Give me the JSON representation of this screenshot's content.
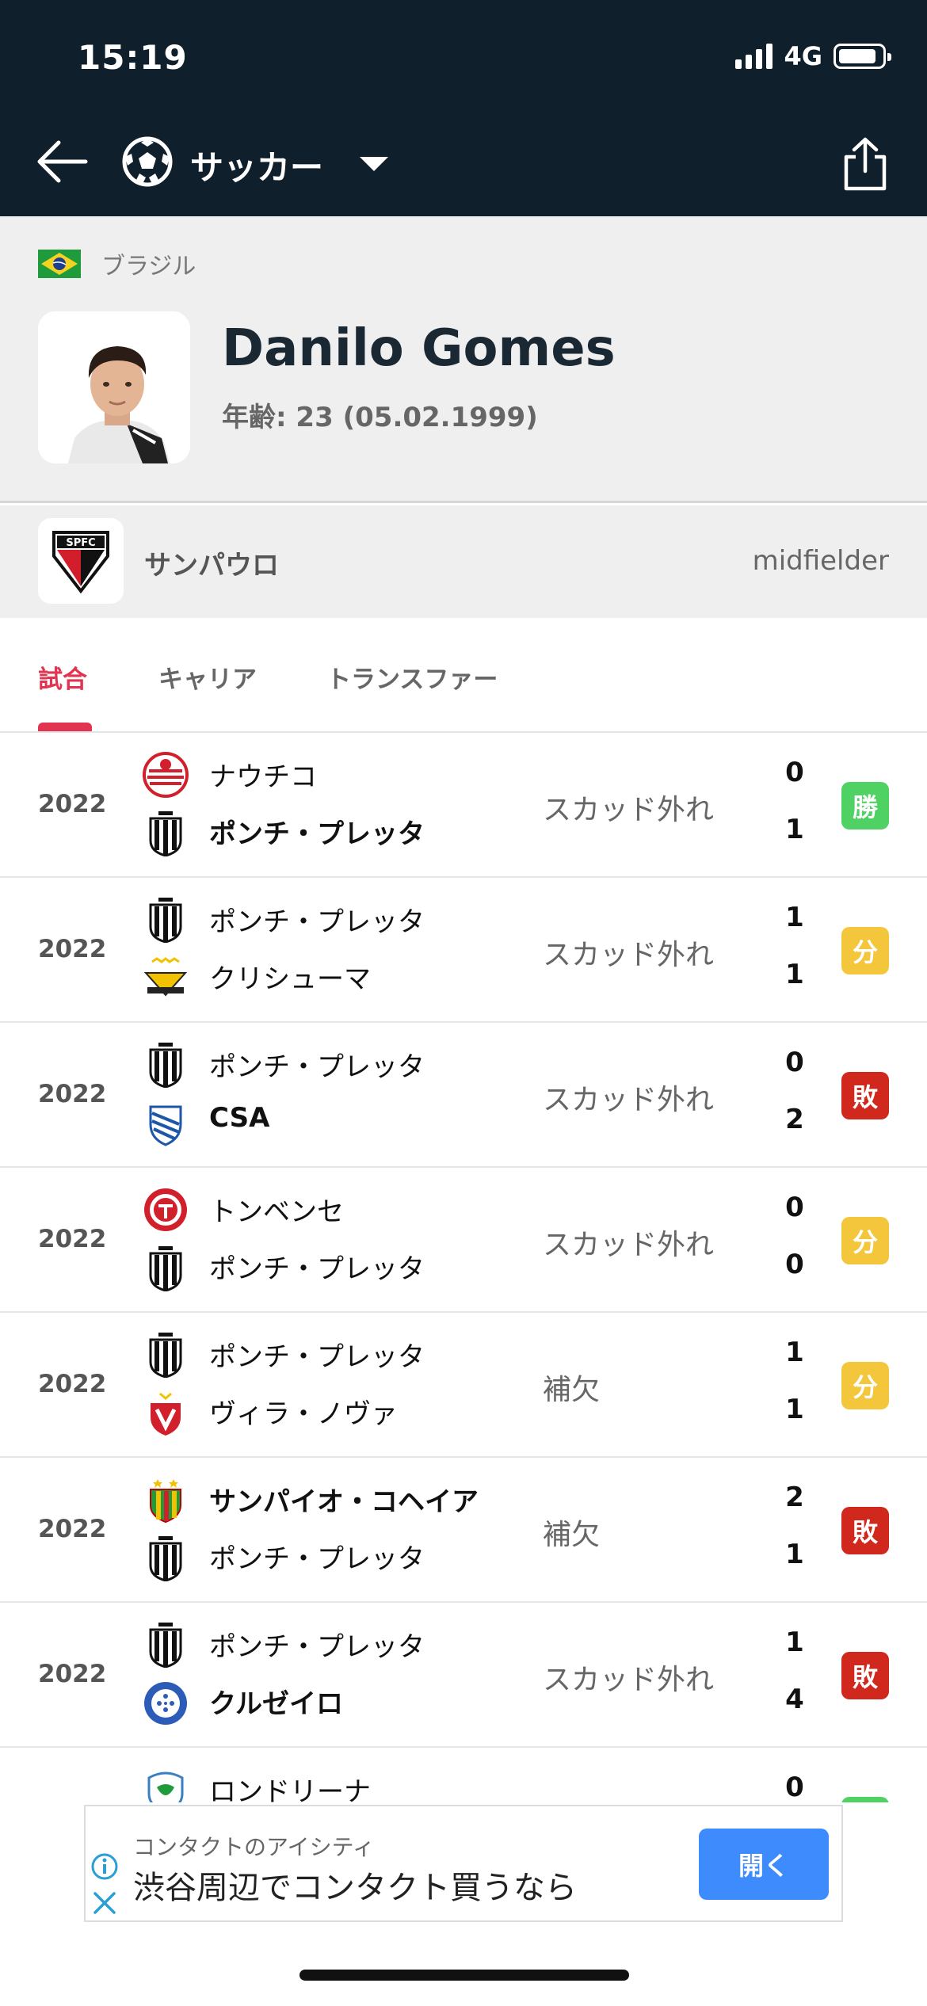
{
  "status": {
    "time": "15:19",
    "network": "4G"
  },
  "nav": {
    "sport": "サッカー"
  },
  "player": {
    "country": "ブラジル",
    "name": "Danilo Gomes",
    "age_line": "年齢: 23 (05.02.1999)"
  },
  "team": {
    "name": "サンパウロ",
    "position": "midfielder",
    "logo_text": "SPFC"
  },
  "tabs": [
    {
      "label": "試合",
      "active": true
    },
    {
      "label": "キャリア",
      "active": false
    },
    {
      "label": "トランスファー",
      "active": false
    }
  ],
  "matches": [
    {
      "year": "2022",
      "home": "ナウチコ",
      "away": "ポンチ・プレッタ",
      "status": "スカッド外れ",
      "home_score": "0",
      "away_score": "1",
      "result": "勝",
      "result_color": "#4fd163",
      "home_logo": "nautico-logo",
      "away_logo": "ponte-preta-logo",
      "winner": "away"
    },
    {
      "year": "2022",
      "home": "ポンチ・プレッタ",
      "away": "クリシューマ",
      "status": "スカッド外れ",
      "home_score": "1",
      "away_score": "1",
      "result": "分",
      "result_color": "#f3c63b",
      "home_logo": "ponte-preta-logo",
      "away_logo": "criciuma-logo",
      "winner": "none"
    },
    {
      "year": "2022",
      "home": "ポンチ・プレッタ",
      "away": "CSA",
      "status": "スカッド外れ",
      "home_score": "0",
      "away_score": "2",
      "result": "敗",
      "result_color": "#d0281c",
      "home_logo": "ponte-preta-logo",
      "away_logo": "csa-logo",
      "winner": "away"
    },
    {
      "year": "2022",
      "home": "トンベンセ",
      "away": "ポンチ・プレッタ",
      "status": "スカッド外れ",
      "home_score": "0",
      "away_score": "0",
      "result": "分",
      "result_color": "#f3c63b",
      "home_logo": "tombense-logo",
      "away_logo": "ponte-preta-logo",
      "winner": "none"
    },
    {
      "year": "2022",
      "home": "ポンチ・プレッタ",
      "away": "ヴィラ・ノヴァ",
      "status": "補欠",
      "home_score": "1",
      "away_score": "1",
      "result": "分",
      "result_color": "#f3c63b",
      "home_logo": "ponte-preta-logo",
      "away_logo": "vila-nova-logo",
      "winner": "none"
    },
    {
      "year": "2022",
      "home": "サンパイオ・コヘイア",
      "away": "ポンチ・プレッタ",
      "status": "補欠",
      "home_score": "2",
      "away_score": "1",
      "result": "敗",
      "result_color": "#d0281c",
      "home_logo": "sampaio-correa-logo",
      "away_logo": "ponte-preta-logo",
      "winner": "home"
    },
    {
      "year": "2022",
      "home": "ポンチ・プレッタ",
      "away": "クルゼイロ",
      "status": "スカッド外れ",
      "home_score": "1",
      "away_score": "4",
      "result": "敗",
      "result_color": "#d0281c",
      "home_logo": "ponte-preta-logo",
      "away_logo": "cruzeiro-logo",
      "winner": "away"
    },
    {
      "year": "",
      "home": "ロンドリーナ",
      "away": "",
      "status": "",
      "home_score": "0",
      "away_score": "",
      "result": "",
      "result_color": "#4fd163",
      "home_logo": "londrina-logo",
      "away_logo": "",
      "winner": "none"
    }
  ],
  "ad": {
    "advertiser": "コンタクトのアイシティ",
    "headline": "渋谷周辺でコンタクト買うなら",
    "button": "開く"
  },
  "colors": {
    "topbar": "#0f1f2b",
    "accent": "#e23350",
    "win": "#4fd163",
    "draw": "#f3c63b",
    "loss": "#d0281c",
    "ad_button": "#3d8bfd"
  }
}
